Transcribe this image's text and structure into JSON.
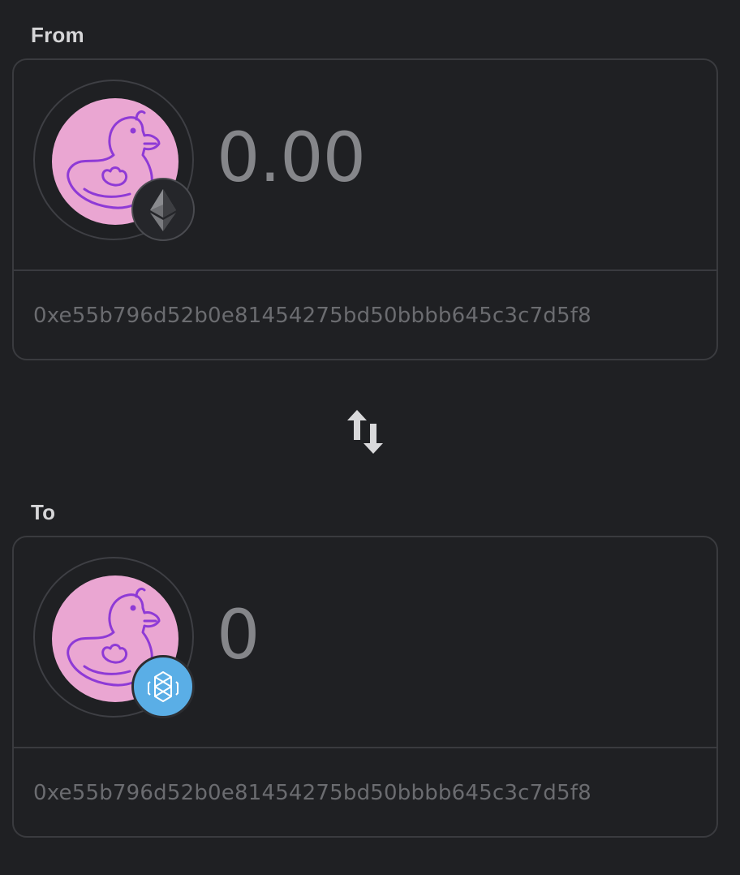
{
  "from": {
    "label": "From",
    "amount": "0.00",
    "address": "0xe55b796d52b0e81454275bd50bbbb645c3c7d5f8",
    "token_icon": "duck-icon",
    "chain_icon": "ethereum-icon"
  },
  "to": {
    "label": "To",
    "amount": "0",
    "address": "0xe55b796d52b0e81454275bd50bbbb645c3c7d5f8",
    "token_icon": "duck-icon",
    "chain_icon": "fantom-icon"
  },
  "swap": {
    "icon": "swap-arrows-icon"
  },
  "colors": {
    "background": "#1f2023",
    "card_border": "#3a3b3f",
    "token_pink": "#eaa6d2",
    "duck_stroke": "#8e3ad6",
    "fantom_blue": "#5aaee6",
    "amount_text": "#85868a",
    "address_text": "#6b6c70"
  }
}
